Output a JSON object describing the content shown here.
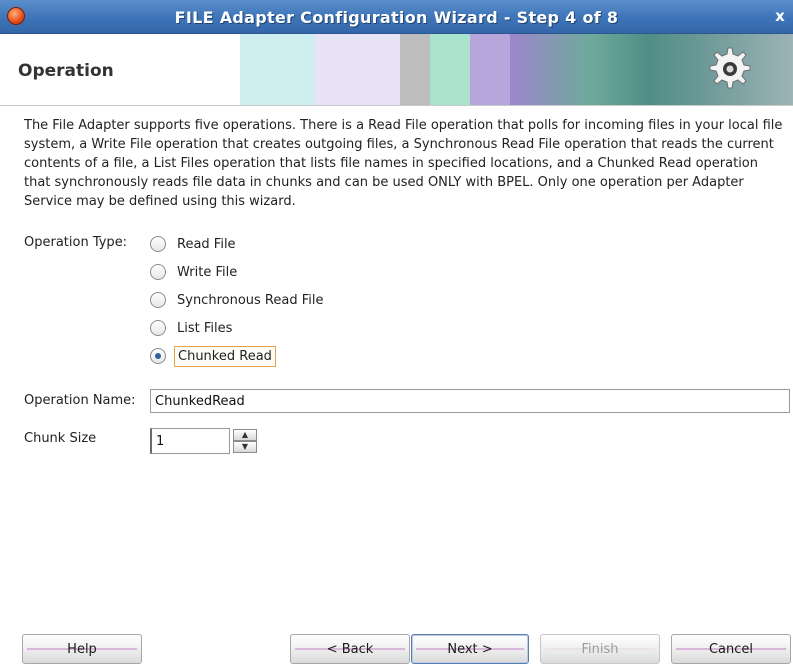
{
  "window": {
    "title": "FILE Adapter Configuration Wizard - Step 4 of 8",
    "close_glyph": "x"
  },
  "header": {
    "title": "Operation"
  },
  "description": "The File Adapter supports five operations.  There is a Read File operation that polls for incoming files in your local file system, a Write File operation that creates outgoing files, a Synchronous Read File operation that reads the current contents of a file, a List Files operation that lists file names in specified locations, and a Chunked Read operation that synchronously reads file data in chunks and can be used ONLY with BPEL. Only one operation per Adapter Service may be defined using this wizard.",
  "operation_type": {
    "label": "Operation Type:",
    "options": [
      {
        "label": "Read File",
        "checked": false
      },
      {
        "label": "Write File",
        "checked": false
      },
      {
        "label": "Synchronous Read File",
        "checked": false
      },
      {
        "label": "List Files",
        "checked": false
      },
      {
        "label": "Chunked Read",
        "checked": true
      }
    ]
  },
  "operation_name": {
    "label": "Operation Name:",
    "value": "ChunkedRead"
  },
  "chunk_size": {
    "label": "Chunk Size",
    "value": "1"
  },
  "buttons": {
    "help": "Help",
    "back": "< Back",
    "next": "Next >",
    "finish": "Finish",
    "cancel": "Cancel"
  },
  "colors": {
    "titlebar": "#3d74b8",
    "focus_border": "#e6a34a",
    "radio_dot": "#2f5f9c"
  },
  "icons": {
    "app": "oracle-icon",
    "close": "close-icon",
    "banner": "gear-icon"
  }
}
